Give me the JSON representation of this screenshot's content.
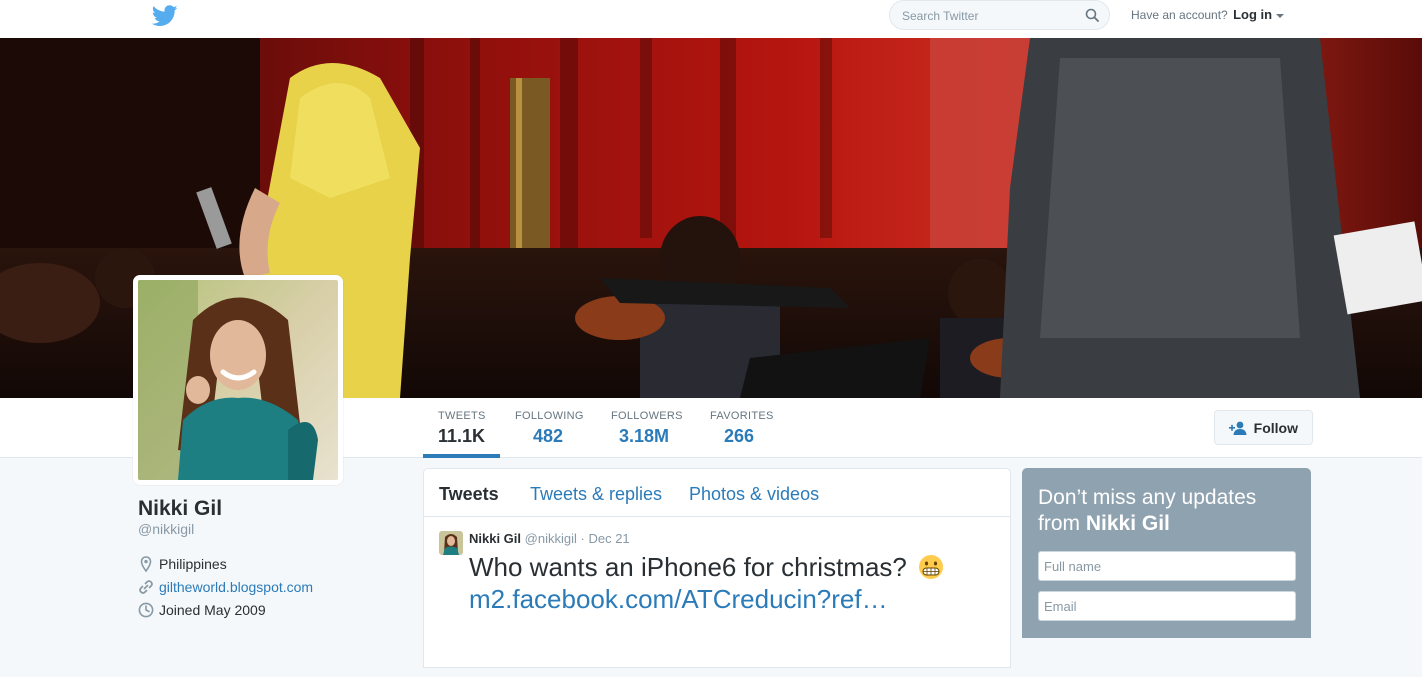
{
  "nav": {
    "logo": "twitter-bird-icon",
    "search_placeholder": "Search Twitter",
    "have_account": "Have an account?",
    "login": "Log in"
  },
  "profile": {
    "name": "Nikki Gil",
    "handle": "@nikkigil",
    "location": "Philippines",
    "website": "giltheworld.blogspot.com",
    "joined": "Joined May 2009"
  },
  "stats": [
    {
      "label": "TWEETS",
      "value": "11.1K"
    },
    {
      "label": "FOLLOWING",
      "value": "482"
    },
    {
      "label": "FOLLOWERS",
      "value": "3.18M"
    },
    {
      "label": "FAVORITES",
      "value": "266"
    }
  ],
  "follow_label": "Follow",
  "timeline": {
    "tabs": [
      "Tweets",
      "Tweets & replies",
      "Photos & videos"
    ],
    "tweet": {
      "name": "Nikki Gil",
      "handle": "@nikkigil",
      "separator": "·",
      "date": "Dec 21",
      "text": "Who wants an iPhone6 for christmas?",
      "link": "m2.facebook.com/ATCreducin?ref…"
    }
  },
  "signup": {
    "title_prefix": "Don’t miss any updates from",
    "title_name": "Nikki Gil",
    "fullname_placeholder": "Full name",
    "email_placeholder": "Email"
  },
  "colors": {
    "link": "#2b7bb9",
    "signup_bg": "#8fa2b0",
    "twitter_blue": "#55acee"
  }
}
